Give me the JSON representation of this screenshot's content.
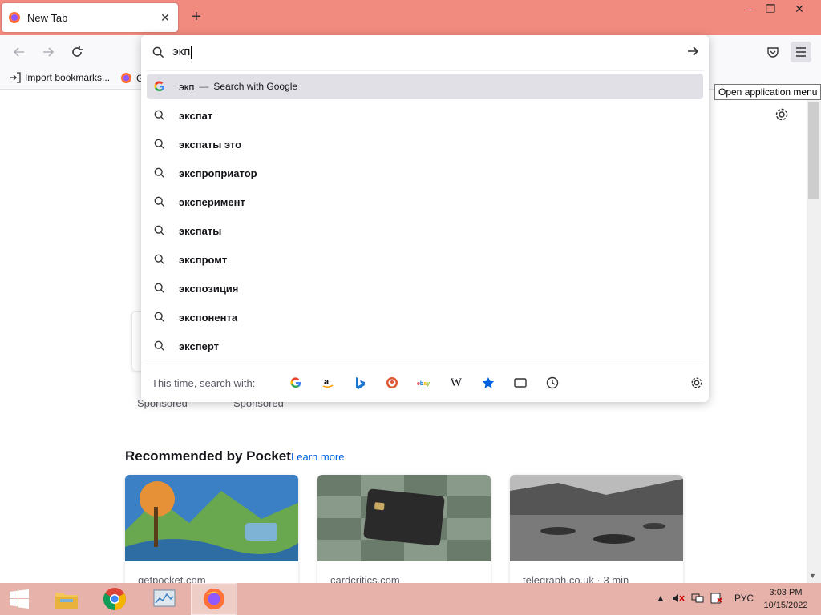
{
  "browser": {
    "tab": {
      "title": "New Tab"
    },
    "window_controls": {
      "minimize": "–",
      "restore": "❐",
      "close": "✕"
    },
    "bookmarks": [
      {
        "label": "Import bookmarks..."
      },
      {
        "label": "G"
      }
    ],
    "tooltip": "Open application menu"
  },
  "urlbar": {
    "typed": "экп",
    "rows": [
      {
        "text": "экп",
        "action": "Search with Google",
        "selected": true
      },
      {
        "text": "экспат"
      },
      {
        "text": "экспаты это"
      },
      {
        "text": "экспроприатор"
      },
      {
        "text": "эксперимент"
      },
      {
        "text": "экспаты"
      },
      {
        "text": "экспромт"
      },
      {
        "text": "экспозиция"
      },
      {
        "text": "экспонента"
      },
      {
        "text": "эксперт"
      }
    ],
    "one_offs": {
      "label": "This time, search with:",
      "engines": [
        "google-icon",
        "amazon-icon",
        "bing-icon",
        "duckduckgo-icon",
        "ebay-icon",
        "wikipedia-icon",
        "bookmarks-icon",
        "tabs-icon",
        "history-icon"
      ],
      "wiki_glyph": "W",
      "ebay_glyph": "ebay"
    }
  },
  "newtab": {
    "sponsored": [
      "Sponsored",
      "Sponsored"
    ],
    "pocket_heading": "Recommended by Pocket",
    "learn_more": "Learn more",
    "stories": [
      {
        "source": "getpocket.com"
      },
      {
        "source": "cardcritics.com"
      },
      {
        "source": "telegraph.co.uk · 3 min"
      }
    ]
  },
  "taskbar": {
    "language": "РУС",
    "time": "3:03 PM",
    "date": "10/15/2022"
  },
  "colors": {
    "titlebar": "#f28b7f",
    "taskbar": "#e7b2aa",
    "accent": "#0060df"
  }
}
